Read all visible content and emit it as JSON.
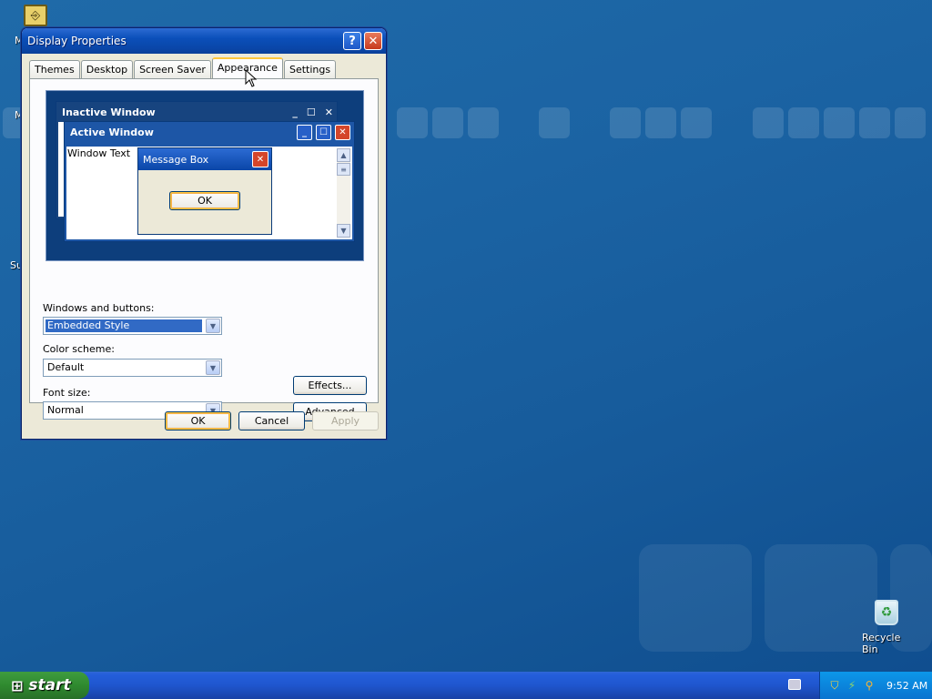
{
  "dialog": {
    "title": "Display Properties",
    "help_glyph": "?",
    "close_glyph": "✕",
    "tabs": [
      {
        "label": "Themes"
      },
      {
        "label": "Desktop"
      },
      {
        "label": "Screen Saver"
      },
      {
        "label": "Appearance"
      },
      {
        "label": "Settings"
      }
    ],
    "active_tab": "Appearance",
    "preview": {
      "inactive_title": "Inactive Window",
      "active_title": "Active Window",
      "window_text": "Window Text",
      "message_title": "Message Box",
      "message_ok": "OK"
    },
    "windows_buttons_label": "Windows and buttons:",
    "windows_buttons_value": "Embedded Style",
    "color_scheme_label": "Color scheme:",
    "color_scheme_value": "Default",
    "font_size_label": "Font size:",
    "font_size_value": "Normal",
    "effects_label": "Effects...",
    "advanced_label": "Advanced",
    "ok_label": "OK",
    "cancel_label": "Cancel",
    "apply_label": "Apply"
  },
  "desktop": {
    "partial_label_1": "M",
    "partial_label_2": "M",
    "partial_label_3": "Su",
    "recycle_bin_label": "Recycle Bin"
  },
  "taskbar": {
    "start_label": "start",
    "clock": "9:52 AM"
  },
  "icons": [
    "help-icon",
    "close-icon",
    "minimize-icon",
    "maximize-icon",
    "dropdown-arrow-icon",
    "windows-flag-icon",
    "keyboard-icon",
    "security-shield-icon",
    "network-icon",
    "search-icon",
    "recycle-bin-icon"
  ],
  "colors": {
    "titlebar": "#0a46a8",
    "desktop": "#1b63a3",
    "start": "#2f8a2f",
    "tray": "#0a74d0"
  }
}
